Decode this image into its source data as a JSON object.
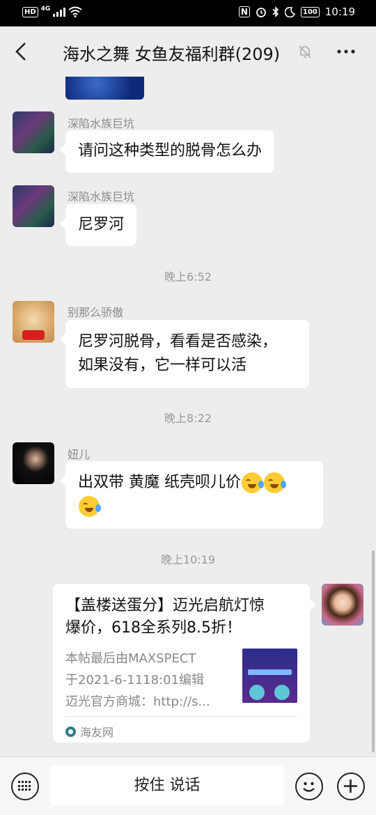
{
  "status_bar": {
    "network": "4G",
    "hd": "HD",
    "battery": "100",
    "time": "10:19",
    "nfc": "N"
  },
  "header": {
    "title": "海水之舞 女鱼友福利群(209)"
  },
  "messages": [
    {
      "sender": "深陷水族巨坑",
      "text": "请问这种类型的脱骨怎么办"
    },
    {
      "sender": "深陷水族巨坑",
      "text": "尼罗河"
    },
    {
      "time": "晚上6:52"
    },
    {
      "sender": "别那么骄傲",
      "line1": "尼罗河脱骨，看看是否感染，",
      "line2": "如果没有，它一样可以活"
    },
    {
      "time": "晚上8:22"
    },
    {
      "sender": "妞儿",
      "text": "出双带 黄魔 纸壳呗儿价"
    },
    {
      "time": "晚上10:19"
    }
  ],
  "card": {
    "title_line1": "【盖楼送蛋分】迈光启航灯惊",
    "title_line2": "爆价，618全系列8.5折！",
    "desc_line1": "本帖最后由MAXSPECT",
    "desc_line2": "于2021-6-1118:01编辑",
    "desc_line3": "迈光官方商城：http://s...",
    "source": "海友网"
  },
  "bottom": {
    "talk_label": "按住 说话"
  },
  "colors": {
    "background": "#ededed",
    "bubble": "#ffffff",
    "meta_text": "#999999"
  }
}
